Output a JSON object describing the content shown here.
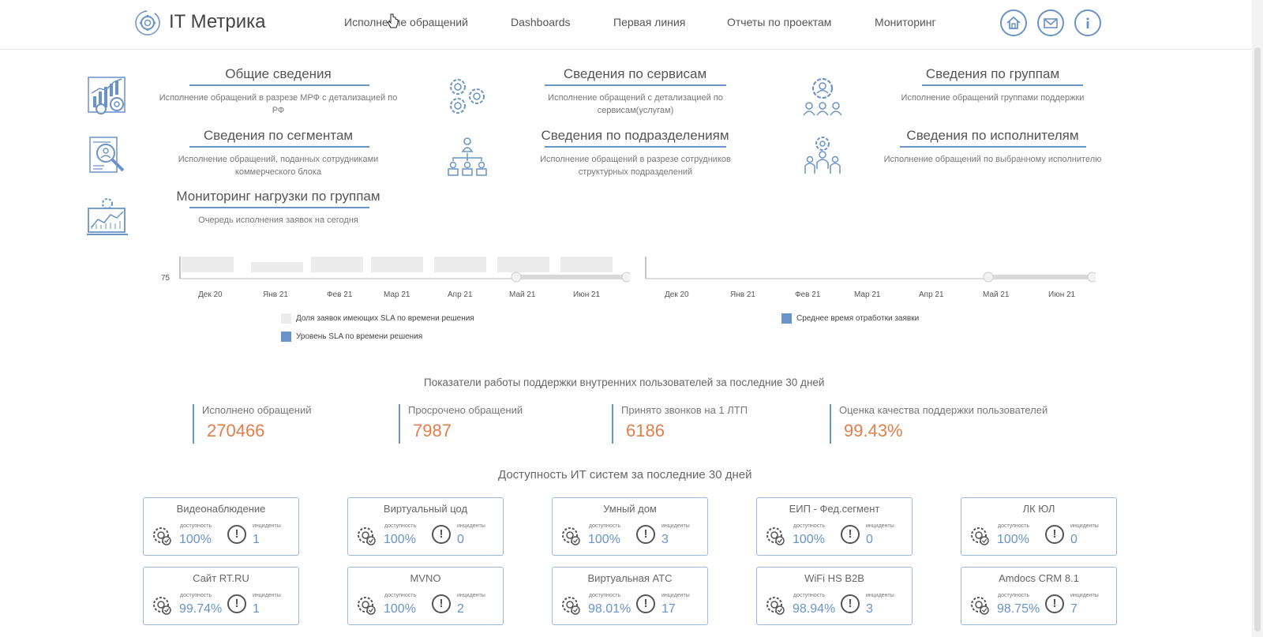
{
  "header": {
    "logo_text": "IT Метрика",
    "nav": [
      "Исполнение обращений",
      "Dashboards",
      "Первая линия",
      "Отчеты по проектам",
      "Мониторинг"
    ],
    "icons": [
      "home-icon",
      "mail-icon",
      "info-icon"
    ]
  },
  "sections": [
    {
      "title": "Общие сведения",
      "desc": "Исполнение обращений в разрезе МРФ с детализацией по РФ",
      "icon": "chart-gears-icon"
    },
    {
      "title": "Сведения по сервисам",
      "desc": "Исполнение обращений с детализацией по сервисам(услугам)",
      "icon": "gears-icon"
    },
    {
      "title": "Сведения по группам",
      "desc": "Исполнение обращений группами поддержки",
      "icon": "group-gear-icon"
    },
    {
      "title": "Сведения по сегментам",
      "desc": "Исполнение обращений, поданных сотрудниками коммерческого блока",
      "icon": "document-search-icon"
    },
    {
      "title": "Сведения по подразделениям",
      "desc": "Исполнение обращений в разрезе сотрудников структурных подразделений",
      "icon": "org-structure-icon"
    },
    {
      "title": "Сведения по исполнителям",
      "desc": "Исполнение обращений по выбранному исполнителю",
      "icon": "person-gear-icon"
    },
    {
      "title": "Мониторинг нагрузки по группам",
      "desc": "Очередь исполнения заявок на сегодня",
      "icon": "monitor-chart-icon"
    }
  ],
  "chart_data": [
    {
      "type": "bar",
      "categories": [
        "Дек 20",
        "Янв 21",
        "Фев 21",
        "Мар 21",
        "Апр 21",
        "Май 21",
        "Июн 21"
      ],
      "ytick_visible": "75",
      "series": [
        {
          "name": "Доля заявок имеющих SLA по времени решения",
          "color": "#ececec"
        },
        {
          "name": "Уровень SLA по времени решения",
          "color": "#6a93c7"
        }
      ]
    },
    {
      "type": "line",
      "categories": [
        "Дек 20",
        "Янв 21",
        "Фев 21",
        "Мар 21",
        "Апр 21",
        "Май 21",
        "Июн 21"
      ],
      "series": [
        {
          "name": "Среднее время отработки заявки",
          "color": "#6a93c7"
        }
      ]
    }
  ],
  "kpi": {
    "title": "Показатели работы поддержки внутренних пользователей за последние 30 дней",
    "items": [
      {
        "label": "Исполнено обращений",
        "value": "270466"
      },
      {
        "label": "Просрочено обращений",
        "value": "7987"
      },
      {
        "label": "Принято звонков на 1 ЛТП",
        "value": "6186"
      },
      {
        "label": "Оценка качества поддержки пользователей",
        "value": "99.43%"
      }
    ]
  },
  "availability": {
    "title": "Доступность ИТ систем за последние 30 дней",
    "small_availability": "доступность",
    "small_incidents": "инциденты",
    "cards": [
      {
        "name": "Видеонаблюдение",
        "availability": "100%",
        "incidents": "1"
      },
      {
        "name": "Виртуальный цод",
        "availability": "100%",
        "incidents": "0"
      },
      {
        "name": "Умный дом",
        "availability": "100%",
        "incidents": "3"
      },
      {
        "name": "ЕИП - Фед.сегмент",
        "availability": "100%",
        "incidents": "0"
      },
      {
        "name": "ЛК ЮЛ",
        "availability": "100%",
        "incidents": "0"
      },
      {
        "name": "Сайт RT.RU",
        "availability": "99.74%",
        "incidents": "1"
      },
      {
        "name": "MVNO",
        "availability": "100%",
        "incidents": "2"
      },
      {
        "name": "Виртуальная АТС",
        "availability": "98.01%",
        "incidents": "17"
      },
      {
        "name": "WiFi HS B2B",
        "availability": "98.94%",
        "incidents": "3"
      },
      {
        "name": "Amdocs CRM 8.1",
        "availability": "98.75%",
        "incidents": "7"
      }
    ]
  }
}
